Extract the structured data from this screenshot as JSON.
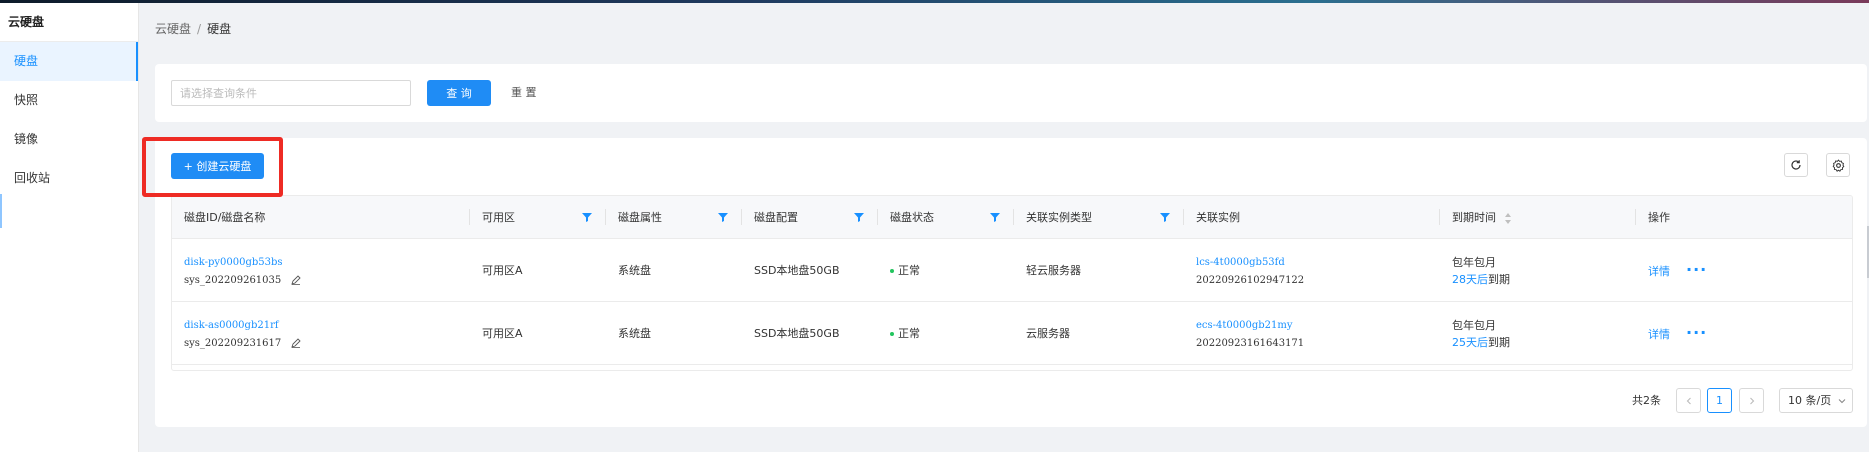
{
  "sidebar": {
    "title": "云硬盘",
    "items": [
      {
        "label": "硬盘",
        "active": true
      },
      {
        "label": "快照",
        "active": false
      },
      {
        "label": "镜像",
        "active": false
      },
      {
        "label": "回收站",
        "active": false
      }
    ]
  },
  "breadcrumb": {
    "parent": "云硬盘",
    "separator": "/",
    "current": "硬盘"
  },
  "search": {
    "placeholder": "请选择查询条件",
    "value": "",
    "query_label": "查 询",
    "reset_label": "重 置"
  },
  "toolbar": {
    "create_label": "+ 创建云硬盘",
    "refresh_icon": "refresh-icon",
    "settings_icon": "gear-icon"
  },
  "table": {
    "columns": [
      "磁盘ID/磁盘名称",
      "可用区",
      "磁盘属性",
      "磁盘配置",
      "磁盘状态",
      "关联实例类型",
      "关联实例",
      "到期时间",
      "操作"
    ],
    "rows": [
      {
        "disk_id": "disk-py0000gb53bs",
        "disk_name": "sys_202209261035",
        "zone": "可用区A",
        "attribute": "系统盘",
        "config": "SSD本地盘50GB",
        "status": "正常",
        "instance_type": "轻云服务器",
        "instance_id": "lcs-4t0000gb53fd",
        "instance_name": "20220926102947122",
        "billing": "包年包月",
        "expire_days": "28天后",
        "expire_suffix": "到期",
        "action_detail": "详情",
        "action_more": "···"
      },
      {
        "disk_id": "disk-as0000gb21rf",
        "disk_name": "sys_202209231617",
        "zone": "可用区A",
        "attribute": "系统盘",
        "config": "SSD本地盘50GB",
        "status": "正常",
        "instance_type": "云服务器",
        "instance_id": "ecs-4t0000gb21my",
        "instance_name": "20220923161643171",
        "billing": "包年包月",
        "expire_days": "25天后",
        "expire_suffix": "到期",
        "action_detail": "详情",
        "action_more": "···"
      }
    ]
  },
  "pagination": {
    "total": "共2条",
    "current_page": "1",
    "page_size": "10 条/页"
  },
  "colors": {
    "primary": "#1f8cf5",
    "link": "#1890ff",
    "status_ok": "#22c55e",
    "highlight": "#ee2b24"
  }
}
